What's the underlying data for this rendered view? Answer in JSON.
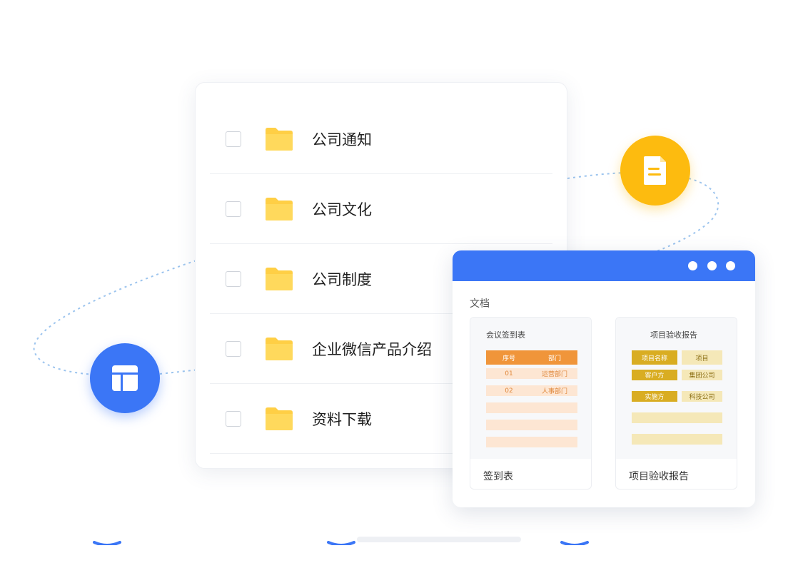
{
  "colors": {
    "accent_blue": "#3b76f6",
    "accent_yellow": "#fdbb0f",
    "folder_yellow": "#ffcf45",
    "orange_header": "#f0953a",
    "peach_row": "#fde6d3",
    "gold_cell": "#d9ad22",
    "pale_gold": "#f5e8b8"
  },
  "icons": {
    "yellow_circle": "document-icon",
    "blue_circle": "layout-icon",
    "folder": "folder-icon"
  },
  "folder_list": {
    "items": [
      {
        "label": "公司通知"
      },
      {
        "label": "公司文化"
      },
      {
        "label": "公司制度"
      },
      {
        "label": "企业微信产品介绍"
      },
      {
        "label": "资料下载"
      }
    ]
  },
  "doc_window": {
    "section_title": "文档",
    "cards": [
      {
        "preview_title": "会议签到表",
        "caption": "签到表",
        "table": {
          "headers": [
            "序号",
            "部门"
          ],
          "rows": [
            [
              "01",
              "运营部门"
            ],
            [
              "02",
              "人事部门"
            ]
          ]
        }
      },
      {
        "preview_title": "项目验收报告",
        "caption": "项目验收报告",
        "fields": [
          {
            "key": "项目名称",
            "value": "项目"
          },
          {
            "key": "客户方",
            "value": "集团公司"
          },
          {
            "key": "实施方",
            "value": "科技公司"
          }
        ]
      }
    ]
  }
}
